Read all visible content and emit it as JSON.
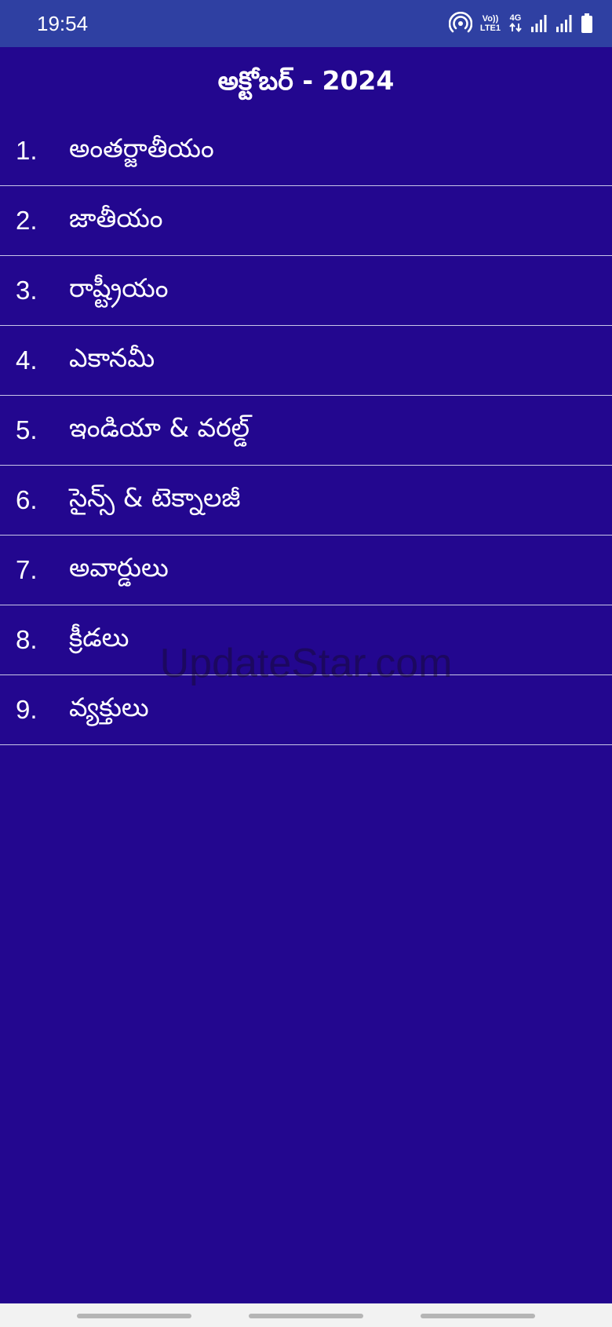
{
  "status_bar": {
    "time": "19:54",
    "volte_top": "Vo))",
    "volte_bottom": "LTE1",
    "network": "4G",
    "icons": [
      "hotspot-icon",
      "volte-icon",
      "4g-data-icon",
      "signal-icon",
      "signal-icon",
      "battery-icon"
    ]
  },
  "header": {
    "title": "అక్టోబర్ - 2024"
  },
  "menu": {
    "items": [
      {
        "number": "1.",
        "label": "అంతర్జాతీయం"
      },
      {
        "number": "2.",
        "label": "జాతీయం"
      },
      {
        "number": "3.",
        "label": "రాష్ట్రీయం"
      },
      {
        "number": "4.",
        "label": "ఎకానమీ"
      },
      {
        "number": "5.",
        "label": "ఇండియా & వరల్డ్"
      },
      {
        "number": "6.",
        "label": "సైన్స్ & టెక్నాలజీ"
      },
      {
        "number": "7.",
        "label": "అవార్డులు"
      },
      {
        "number": "8.",
        "label": "క్రీడలు"
      },
      {
        "number": "9.",
        "label": "వ్యక్తులు"
      }
    ]
  },
  "watermark": "UpdateStar.com",
  "colors": {
    "background": "#23078f",
    "status_bar": "#2f40a2",
    "divider": "#c9c6e8",
    "text": "#ffffff",
    "nav_bar": "#f2f2f2"
  }
}
